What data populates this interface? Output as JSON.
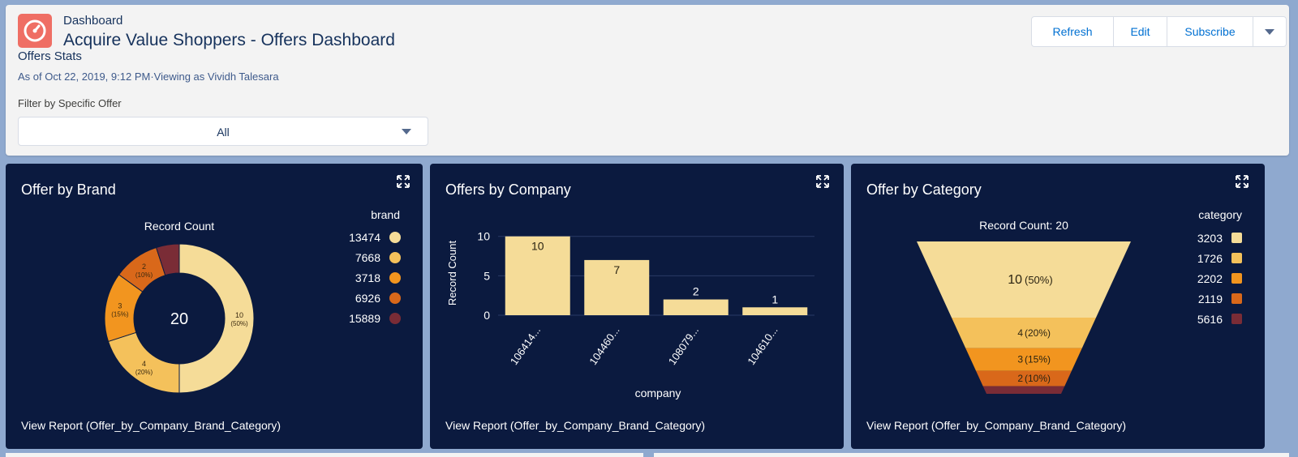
{
  "header": {
    "eyebrow": "Dashboard",
    "title": "Acquire Value Shoppers - Offers Dashboard",
    "subtitle": "Offers Stats",
    "as_of": "As of Oct 22, 2019, 9:12 PM·Viewing as Vividh Talesara",
    "buttons": {
      "refresh": "Refresh",
      "edit": "Edit",
      "subscribe": "Subscribe"
    },
    "filter": {
      "label": "Filter by Specific Offer",
      "value": "All"
    }
  },
  "colors": {
    "accent": "#0070d2",
    "panel_bg": "#0b1a3f",
    "app_icon": "#ef6e64",
    "palette": [
      "#f5dc98",
      "#f4c15b",
      "#f2951f",
      "#d9681a",
      "#7a2c36"
    ]
  },
  "panels": {
    "brand": {
      "title": "Offer by Brand",
      "view_report": "View Report (Offer_by_Company_Brand_Category)"
    },
    "company": {
      "title": "Offers by Company",
      "view_report": "View Report (Offer_by_Company_Brand_Category)"
    },
    "category": {
      "title": "Offer by Category",
      "view_report": "View Report (Offer_by_Company_Brand_Category)"
    }
  },
  "chart_data": [
    {
      "type": "pie",
      "variant": "donut",
      "title": "Record Count",
      "center_label": "20",
      "legend_title": "brand",
      "legend_position": "right",
      "categories": [
        "13474",
        "7668",
        "3718",
        "6926",
        "15889"
      ],
      "values": [
        10,
        4,
        3,
        2,
        1
      ],
      "labels": [
        "10",
        "4",
        "3",
        "2",
        ""
      ],
      "percent_labels": [
        "(50%)",
        "(20%)",
        "(15%)",
        "(10%)",
        ""
      ],
      "colors": [
        "#f5dc98",
        "#f4c15b",
        "#f2951f",
        "#d9681a",
        "#7a2c36"
      ]
    },
    {
      "type": "bar",
      "title": "",
      "xlabel": "company",
      "ylabel": "Record Count",
      "categories": [
        "106414...",
        "104460...",
        "108079...",
        "104610..."
      ],
      "values": [
        10,
        7,
        2,
        1
      ],
      "ylim": [
        0,
        11
      ],
      "yticks": [
        0,
        5,
        10
      ],
      "grid": true,
      "color": "#f5dc98"
    },
    {
      "type": "funnel",
      "title": "Record Count: 20",
      "legend_title": "category",
      "legend_position": "right",
      "categories": [
        "3203",
        "1726",
        "2202",
        "2119",
        "5616"
      ],
      "values": [
        10,
        4,
        3,
        2,
        1
      ],
      "value_labels": [
        "10",
        "4",
        "3",
        "2",
        ""
      ],
      "percent_labels": [
        "(50%)",
        "(20%)",
        "(15%)",
        "(10%)",
        ""
      ],
      "colors": [
        "#f5dc98",
        "#f4c15b",
        "#f2951f",
        "#d9681a",
        "#7a2c36"
      ]
    }
  ]
}
